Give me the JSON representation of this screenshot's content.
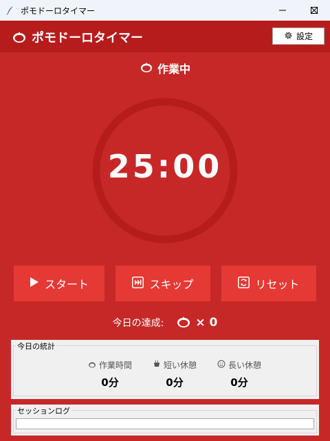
{
  "window": {
    "title": "ポモドーロタイマー"
  },
  "header": {
    "title": "ポモドーロタイマー",
    "settings_label": "設定"
  },
  "status": {
    "label": "作業中"
  },
  "timer": {
    "display": "25:00"
  },
  "controls": {
    "start_label": "スタート",
    "skip_label": "スキップ",
    "reset_label": "リセット"
  },
  "achievement": {
    "label": "今日の達成:",
    "count": "× 0"
  },
  "stats": {
    "title": "今日の統計",
    "items": [
      {
        "label": "作業時間",
        "value": "0分"
      },
      {
        "label": "短い休憩",
        "value": "0分"
      },
      {
        "label": "長い休憩",
        "value": "0分"
      }
    ]
  },
  "log": {
    "title": "セッションログ"
  },
  "colors": {
    "background": "#c62828",
    "header": "#b71c1c",
    "button": "#e53935",
    "ring": "#b71c1c"
  }
}
